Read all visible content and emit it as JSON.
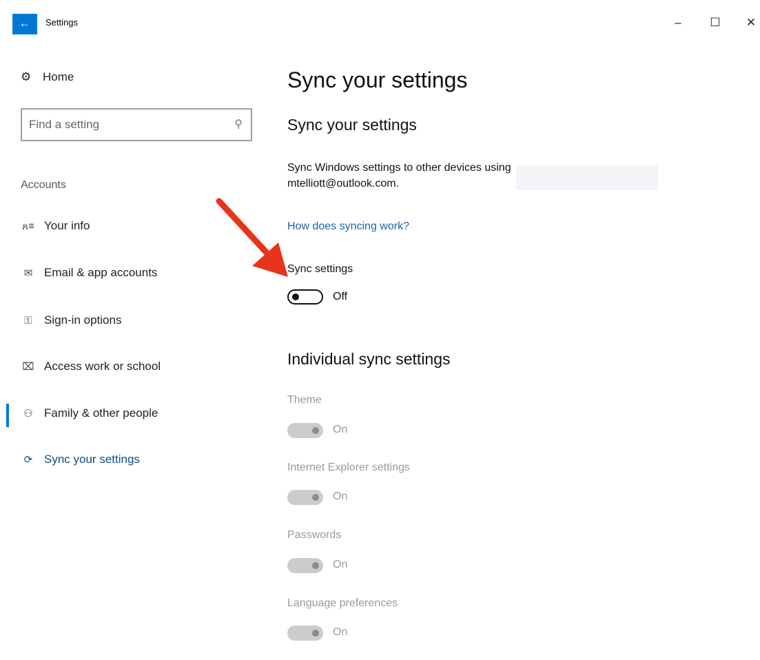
{
  "window": {
    "title": "Settings",
    "back_glyph": "←",
    "min_glyph": "–",
    "max_glyph": "☐",
    "close_glyph": "✕"
  },
  "sidebar": {
    "home_label": "Home",
    "search_placeholder": "Find a setting",
    "section_label": "Accounts",
    "items": [
      {
        "label": "Your info",
        "icon": "person-list-icon",
        "glyph": "ጸ≡"
      },
      {
        "label": "Email & app accounts",
        "icon": "mail-icon",
        "glyph": "✉"
      },
      {
        "label": "Sign-in options",
        "icon": "key-icon",
        "glyph": "⚿"
      },
      {
        "label": "Access work or school",
        "icon": "briefcase-icon",
        "glyph": "⌧"
      },
      {
        "label": "Family & other people",
        "icon": "add-person-icon",
        "glyph": "⚇"
      },
      {
        "label": "Sync your settings",
        "icon": "sync-icon",
        "glyph": "⟳"
      }
    ],
    "active_index": 5
  },
  "main": {
    "page_title": "Sync your settings",
    "section_title": "Sync your settings",
    "description": "Sync Windows settings to other devices using mtelliott@outlook.com.",
    "link": "How does syncing work?",
    "sync_toggle": {
      "label": "Sync settings",
      "state": "Off",
      "on": false
    },
    "individual_title": "Individual sync settings",
    "individual": [
      {
        "label": "Theme",
        "state": "On",
        "on": true,
        "enabled": false
      },
      {
        "label": "Internet Explorer settings",
        "state": "On",
        "on": true,
        "enabled": false
      },
      {
        "label": "Passwords",
        "state": "On",
        "on": true,
        "enabled": false
      },
      {
        "label": "Language preferences",
        "state": "On",
        "on": true,
        "enabled": false
      }
    ]
  },
  "colors": {
    "accent": "#0078d7",
    "link": "#2061a6",
    "annotation_arrow": "#e8341c"
  }
}
